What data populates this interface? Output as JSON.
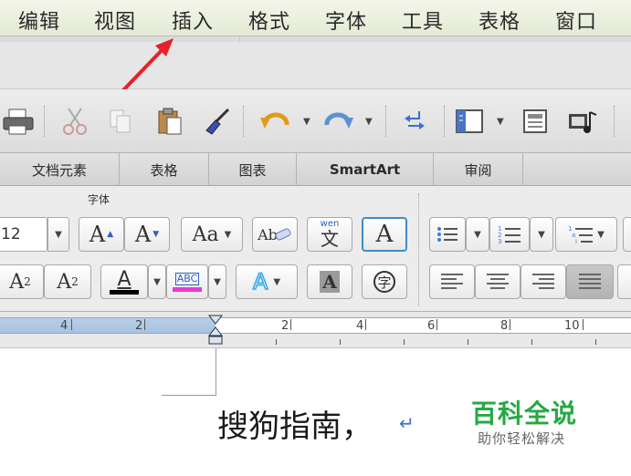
{
  "menubar": {
    "items": [
      "编辑",
      "视图",
      "插入",
      "格式",
      "字体",
      "工具",
      "表格",
      "窗口"
    ]
  },
  "tabs": [
    "文档元素",
    "表格",
    "图表",
    "SmartArt",
    "审阅"
  ],
  "ribbon": {
    "font_group_title": "字体",
    "font_size": "12",
    "grow_font": "A",
    "shrink_font": "A",
    "change_case": "Aa",
    "clear_format": "Ab",
    "phonetic_top": "wen",
    "phonetic_bottom": "文",
    "char_border": "A",
    "superscript_base": "A",
    "superscript_mark": "2",
    "subscript_base": "A",
    "subscript_mark": "2",
    "font_color": "A",
    "highlight": "ABC",
    "text_effect": "A",
    "char_shading": "A",
    "enclose_char": "字"
  },
  "ruler": {
    "labels": [
      "4",
      "2",
      "2",
      "4",
      "6",
      "8",
      "10"
    ]
  },
  "document": {
    "text": "搜狗指南，",
    "para_mark": "↵"
  },
  "watermark": {
    "title": "百科全说",
    "subtitle": "助你轻松解决"
  },
  "colors": {
    "arrow": "#e8202a",
    "watermark": "#27a845",
    "font_color_bar": "#000000",
    "highlight_bar": "#e83ad6",
    "effect_blue": "#3aa7e8"
  }
}
